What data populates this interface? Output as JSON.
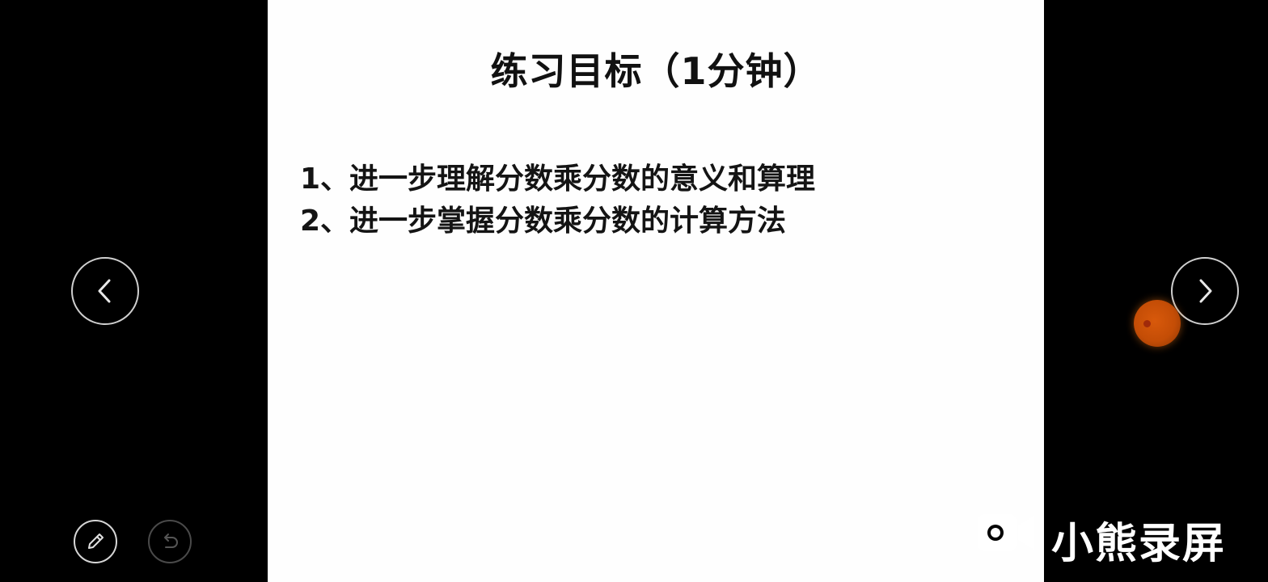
{
  "slide": {
    "title": "练习目标（1分钟）",
    "bullets": [
      "1、进一步理解分数乘分数的意义和算理",
      "2、进一步掌握分数乘分数的计算方法"
    ]
  },
  "navigation": {
    "prev_icon": "chevron-left-icon",
    "next_icon": "chevron-right-icon"
  },
  "tools": {
    "pen_icon": "pen-icon",
    "undo_icon": "undo-icon"
  },
  "watermark": {
    "text": "小熊录屏",
    "logo_icon": "video-camera-icon"
  },
  "colors": {
    "background": "#000000",
    "slide_background": "#fefefe",
    "text": "#111111",
    "floating_ball": "#c44d06"
  }
}
